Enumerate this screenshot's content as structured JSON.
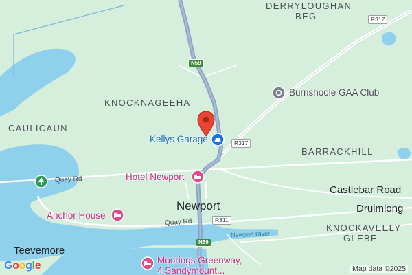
{
  "areas": {
    "derryloughan": "DERRYLOUGHAN",
    "beg": "BEG",
    "knocknageeha": "KNOCKNAGEEHA",
    "caulicaun": "CAULICAUN",
    "barrackhill": "BARRACKHILL",
    "knockaveely": "KNOCKAVEELY",
    "glebe": "GLEBE"
  },
  "towns": {
    "newport": "Newport",
    "castlebar_road": "Castlebar Road",
    "druimlong": "Druimlong",
    "teevemore": "Teevemore"
  },
  "roads": {
    "n59_top": "N59",
    "n59_bottom": "N59",
    "r317_top": "R317",
    "r317_mid": "R317",
    "r311": "R311",
    "quay_rd_1": "Quay Rd",
    "quay_rd_2": "Quay Rd"
  },
  "water": {
    "river": "Newport River"
  },
  "pois": {
    "burrishoole": "Burrishoole GAA Club",
    "kellys_garage": "Kellys Garage",
    "hotel_newport": "Hotel Newport",
    "anchor_house": "Anchor House",
    "moorings_line1": "Moorings Greenway,",
    "moorings_line2": "4 Sandymount..."
  },
  "icons": {
    "pin": "location-pin-icon",
    "garage": "car-repair-icon",
    "hotel": "hotel-bed-icon",
    "park": "tree-icon",
    "club": "place-marker-icon"
  },
  "colors": {
    "land": "#d5efdc",
    "water": "#8fd0ec",
    "major_road": "#8fa8c8",
    "minor_road": "#ffffff",
    "pin": "#e94335",
    "poi_pink": "#c2307f",
    "poi_blue": "#1a6fb8"
  },
  "logo": "Google",
  "attribution": "Map data ©2025"
}
